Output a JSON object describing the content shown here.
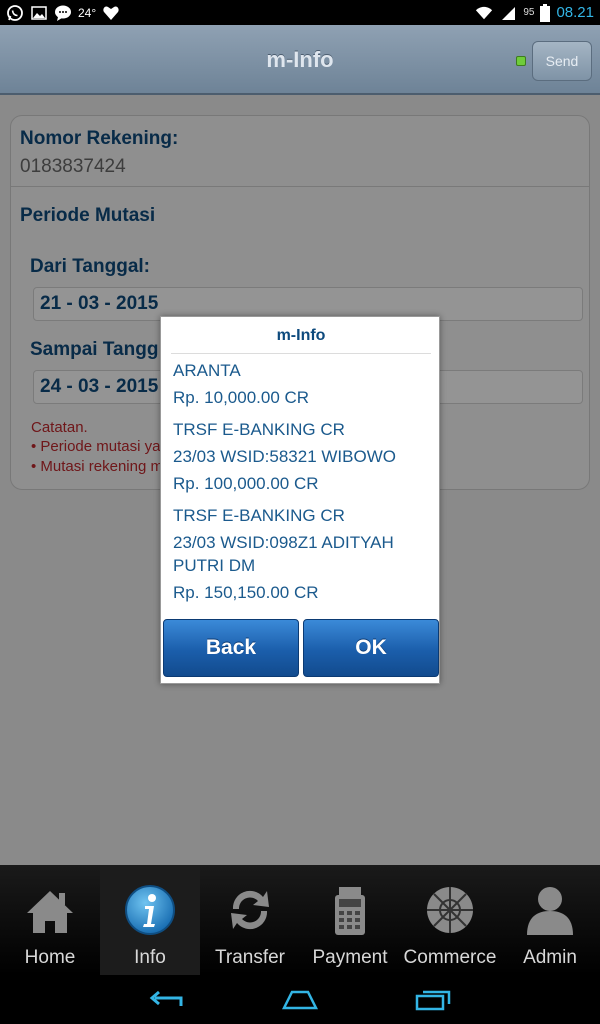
{
  "status_bar": {
    "temperature": "24°",
    "battery": "95",
    "time": "08.21",
    "icons": [
      "whatsapp-icon",
      "gallery-icon",
      "chat-icon",
      "heart-icon",
      "wifi-icon",
      "signal-icon",
      "battery-icon"
    ]
  },
  "header": {
    "title": "m-Info",
    "send_label": "Send",
    "led_color": "#6fcc3a"
  },
  "form": {
    "account_label": "Nomor Rekening:",
    "account_number": "0183837424",
    "period_label": "Periode Mutasi",
    "from_label": "Dari Tanggal:",
    "from_date": "21 - 03 - 2015",
    "to_label": "Sampai Tangg",
    "to_date": "24 - 03 - 2015",
    "note_head": "Catatan.",
    "note_1": "• Periode mutasi ya",
    "note_2": "• Mutasi rekening m"
  },
  "dialog": {
    "title": "m-Info",
    "transactions": [
      {
        "line1": "ARANTA",
        "line2": "",
        "line3": "",
        "amount": "Rp. 10,000.00 CR"
      },
      {
        "line1": "TRSF E-BANKING CR",
        "line2": "23/03 WSID:58321 WIBOWO",
        "line3": "",
        "amount": "Rp. 100,000.00 CR"
      },
      {
        "line1": "TRSF E-BANKING CR",
        "line2": "23/03 WSID:098Z1 ADITYAH",
        "line3": "PUTRI DM",
        "amount": "Rp. 150,150.00 CR"
      }
    ],
    "back_label": "Back",
    "ok_label": "OK"
  },
  "bottom_nav": {
    "items": [
      {
        "label": "Home",
        "icon": "home-icon"
      },
      {
        "label": "Info",
        "icon": "info-icon"
      },
      {
        "label": "Transfer",
        "icon": "transfer-icon"
      },
      {
        "label": "Payment",
        "icon": "payment-icon"
      },
      {
        "label": "Commerce",
        "icon": "commerce-icon"
      },
      {
        "label": "Admin",
        "icon": "admin-icon"
      }
    ],
    "active": "Info"
  },
  "colors": {
    "accent": "#0e4a7d",
    "note_red": "#c0282d",
    "clock_blue": "#33b5e5"
  }
}
